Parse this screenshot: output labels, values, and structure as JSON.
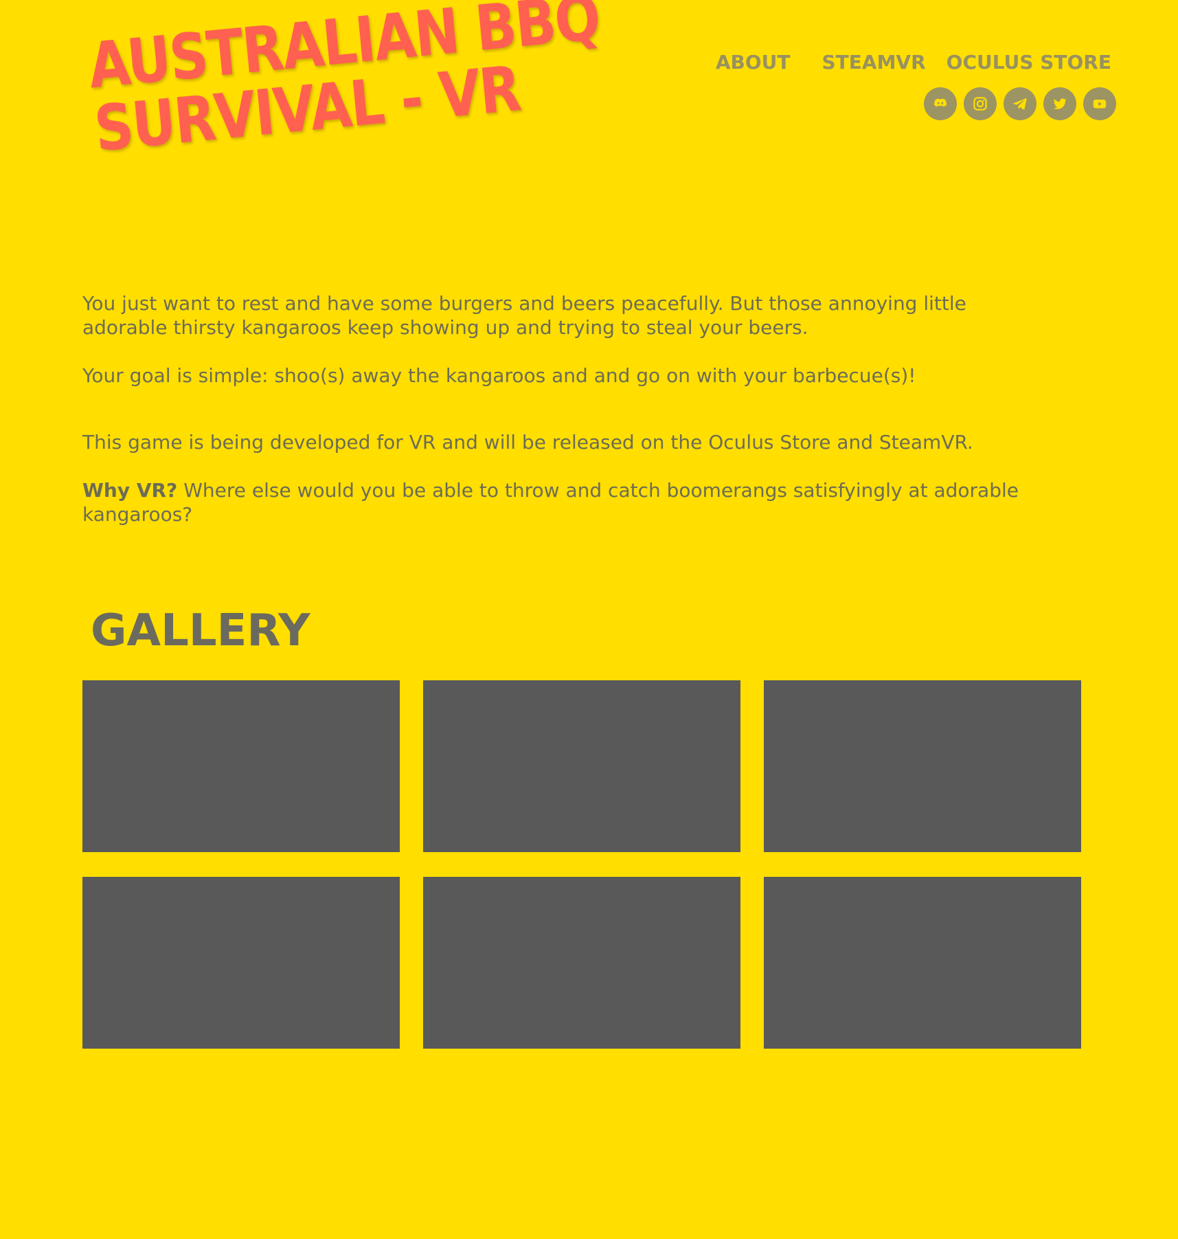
{
  "site": {
    "title_line1": "AUSTRALIAN BBQ",
    "title_line2": "SURVIVAL - VR"
  },
  "nav": {
    "items": [
      {
        "label": "ABOUT"
      },
      {
        "label": "STEAMVR"
      },
      {
        "label": "OCULUS STORE"
      }
    ]
  },
  "socials": [
    {
      "icon": "discord-icon"
    },
    {
      "icon": "instagram-icon"
    },
    {
      "icon": "telegram-icon"
    },
    {
      "icon": "twitter-icon"
    },
    {
      "icon": "youtube-icon"
    }
  ],
  "about": {
    "p1": "You just want to rest and have some burgers and beers peacefully. But those annoying little adorable thirsty kangaroos keep showing up and trying to steal your beers.",
    "p2": "Your goal is simple: shoo(s) away the kangaroos and and go on with your barbecue(s)!",
    "p3": "This game is being developed for VR and will be released on the Oculus Store and SteamVR.",
    "p4_bold": "Why VR?",
    "p4_text": " Where else would you be able to throw and catch boomerangs satisfyingly at adorable kangaroos?"
  },
  "gallery": {
    "title": "GALLERY",
    "item_count": 6
  },
  "colors": {
    "background": "#FFDE00",
    "title": "#FF6050",
    "nav": "#999160",
    "text": "#6d6c55",
    "gallery_placeholder": "#595959"
  }
}
